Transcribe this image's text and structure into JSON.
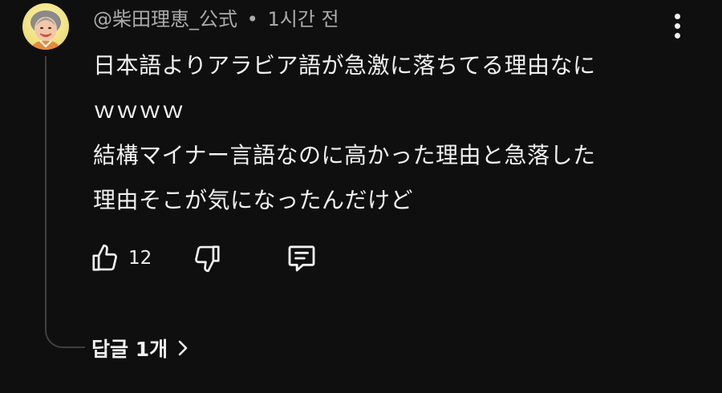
{
  "comment": {
    "author": "@柴田理恵_公式",
    "separator": "•",
    "timestamp": "1시간 전",
    "text_lines": [
      "日本語よりアラビア語が急激に落ちてる理由なに",
      "ｗｗｗｗ",
      "結構マイナー言語なのに高かった理由と急落した",
      "理由そこが気になったんだけど"
    ],
    "like_count": "12",
    "replies_label": "답글 1개"
  },
  "icons": {
    "more": "more-vert-icon",
    "like": "thumb-up-icon",
    "dislike": "thumb-down-icon",
    "reply": "comment-icon",
    "replies_chevron": "chevron-right-icon"
  },
  "colors": {
    "background": "#0f0f0f",
    "text": "#f1f1f1",
    "muted": "#aaaaaa",
    "thread_line": "#3f3f3f"
  }
}
